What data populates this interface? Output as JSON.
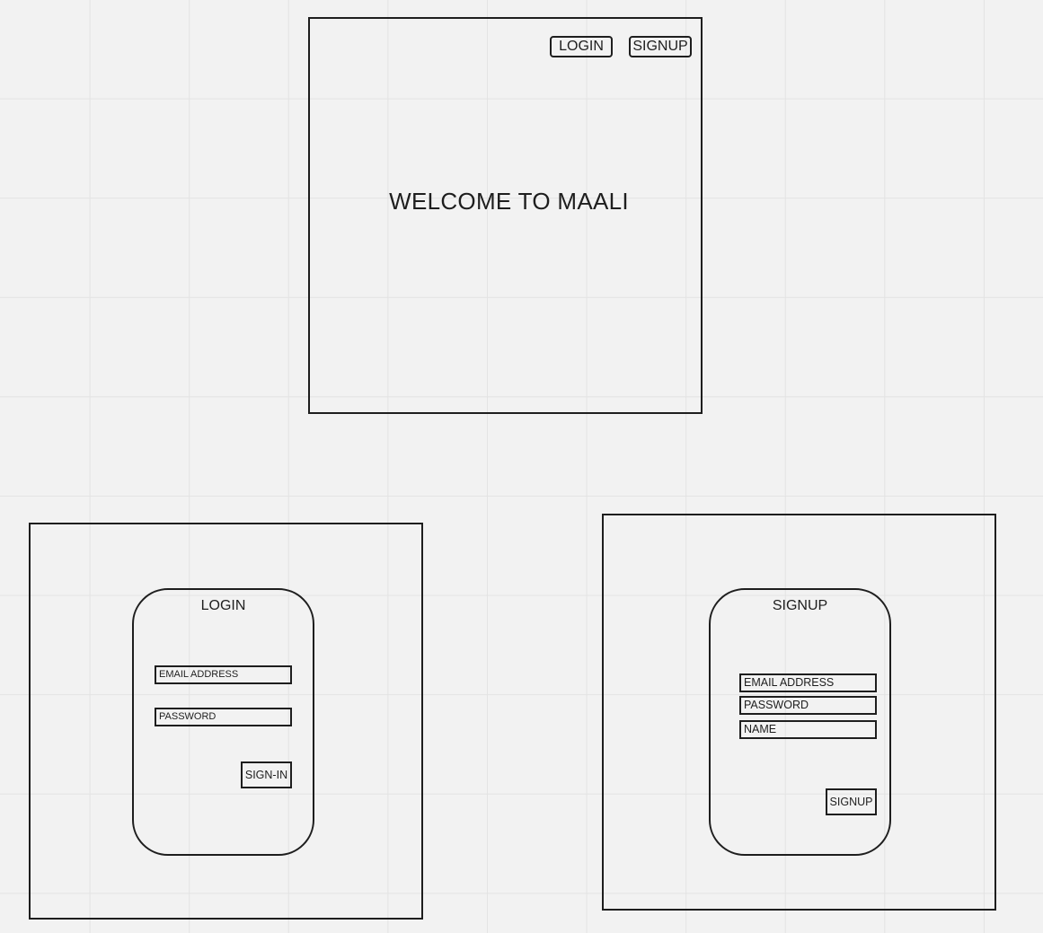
{
  "home": {
    "login_button": "LOGIN",
    "signup_button": "SIGNUP",
    "welcome_text": "WELCOME TO MAALI"
  },
  "login": {
    "title": "LOGIN",
    "email_field": "EMAIL ADDRESS",
    "password_field": "PASSWORD",
    "submit_button": "SIGN-IN"
  },
  "signup": {
    "title": "SIGNUP",
    "email_field": "EMAIL ADDRESS",
    "password_field": "PASSWORD",
    "name_field": "NAME",
    "submit_button": "SIGNUP"
  },
  "colors": {
    "background": "#f2f2f2",
    "grid": "#e3e3e3",
    "stroke": "#1e1e1e"
  }
}
